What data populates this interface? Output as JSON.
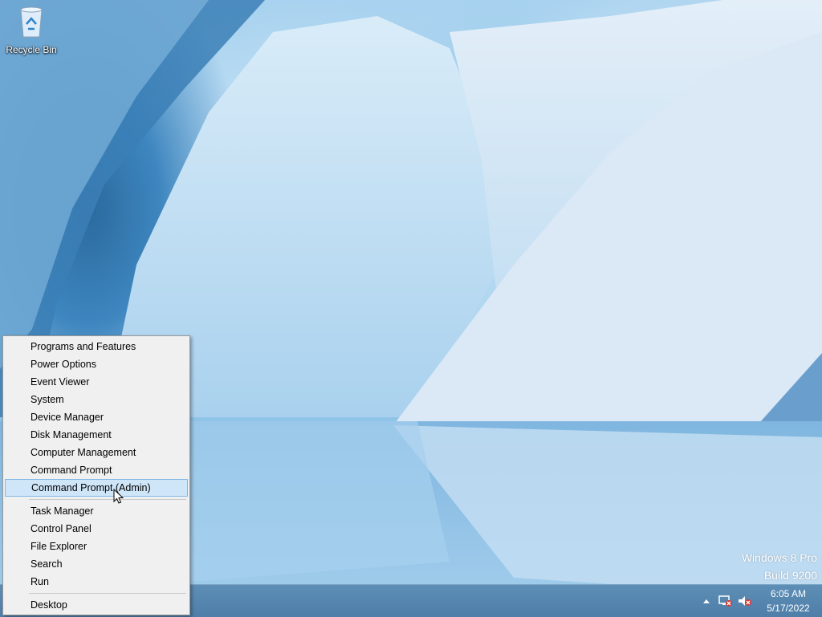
{
  "desktop": {
    "recycle_bin_label": "Recycle Bin",
    "watermark_line1": "Windows 8 Pro",
    "watermark_line2": "Build 9200"
  },
  "context_menu": {
    "groups": [
      [
        "Programs and Features",
        "Power Options",
        "Event Viewer",
        "System",
        "Device Manager",
        "Disk Management",
        "Computer Management",
        "Command Prompt",
        "Command Prompt (Admin)"
      ],
      [
        "Task Manager",
        "Control Panel",
        "File Explorer",
        "Search",
        "Run"
      ],
      [
        "Desktop"
      ]
    ],
    "highlighted": "Command Prompt (Admin)"
  },
  "taskbar": {
    "tray_icons": [
      "chevron-up-icon",
      "network-disconnected-icon",
      "volume-muted-icon"
    ],
    "time": "6:05 AM",
    "date": "5/17/2022"
  },
  "colors": {
    "menu_highlight": "#cfe5f8",
    "menu_highlight_border": "#83b8e6",
    "taskbar": "#5586ae"
  }
}
